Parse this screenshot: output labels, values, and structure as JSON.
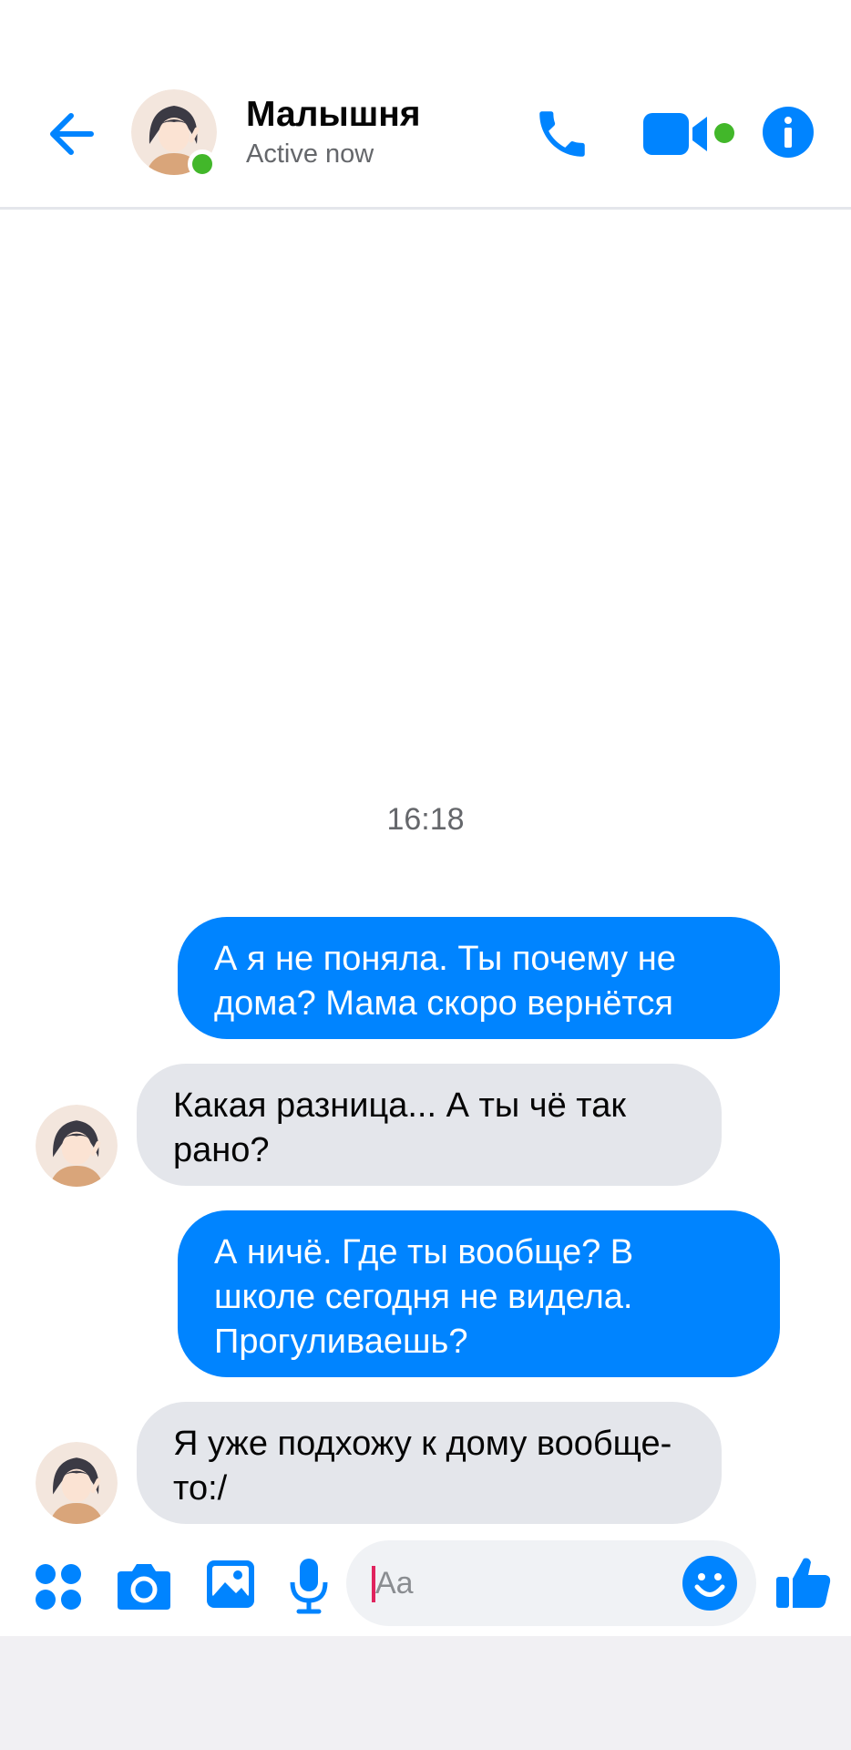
{
  "header": {
    "contact_name": "Малышня",
    "status": "Active now",
    "icons": {
      "back": "arrow-left-icon",
      "call": "phone-icon",
      "video": "video-camera-icon",
      "info": "info-icon"
    }
  },
  "conversation": {
    "timestamp": "16:18",
    "messages": [
      {
        "direction": "outgoing",
        "text": "А я не поняла. Ты почему не дома? Мама скоро вернётся"
      },
      {
        "direction": "incoming",
        "text": "Какая разница... А ты чё так рано?"
      },
      {
        "direction": "outgoing",
        "text": "А ничё. Где ты вообще? В школе сегодня не видела. Прогуливаешь?"
      },
      {
        "direction": "incoming",
        "text": "Я уже подхожу к дому вообще-то:/"
      }
    ]
  },
  "composer": {
    "placeholder": "Aa",
    "icons": [
      "apps-grid-icon",
      "camera-icon",
      "gallery-icon",
      "microphone-icon",
      "emoji-icon",
      "thumbs-up-icon"
    ]
  },
  "colors": {
    "accent": "#0084ff",
    "online": "#42b72a",
    "incoming_bubble": "#e4e6eb"
  }
}
